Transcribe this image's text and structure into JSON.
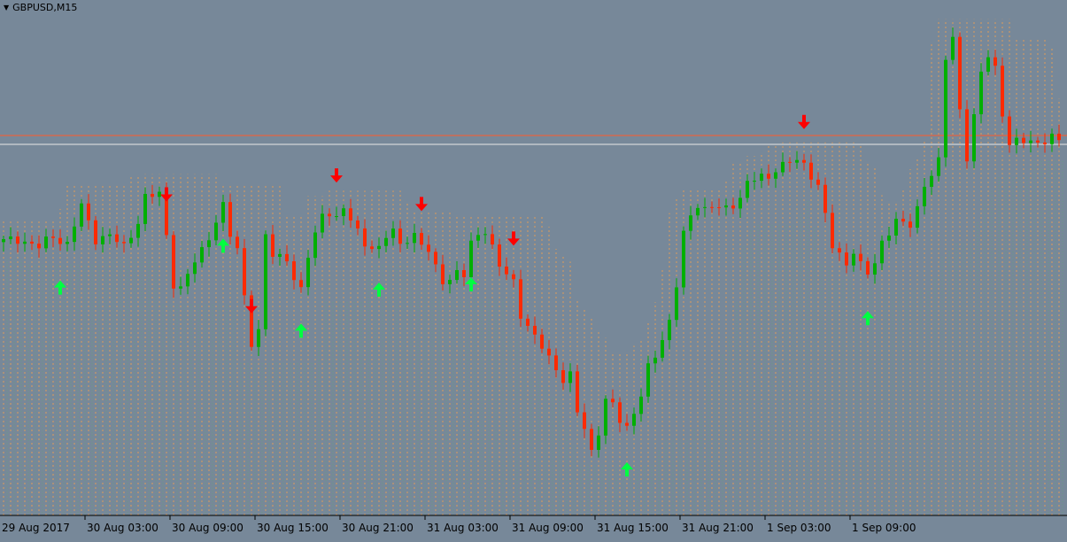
{
  "window": {
    "symbol_label": "GBPUSD,M15",
    "dropdown_icon": "triangle-down-icon"
  },
  "colors": {
    "background": "#778899",
    "bull_candle": "#00b000",
    "bear_candle": "#ff2a00",
    "upper_band": "#f0a050",
    "lower_band": "#66a080",
    "buy_arrow": "#00ff40",
    "sell_arrow": "#ff0000",
    "level_red": "#ff5a2a",
    "level_white": "#e8e8e8"
  },
  "chart_data": {
    "type": "candlestick",
    "symbol": "GBPUSD",
    "timeframe": "M15",
    "x_tick_labels": [
      "29 Aug 2017",
      "30 Aug 03:00",
      "30 Aug 09:00",
      "30 Aug 15:00",
      "30 Aug 21:00",
      "31 Aug 03:00",
      "31 Aug 09:00",
      "31 Aug 15:00",
      "31 Aug 21:00",
      "1 Sep 03:00",
      "1 Sep 09:00"
    ],
    "price_path": [
      [
        0,
        0.93
      ],
      [
        2,
        0.94
      ],
      [
        5,
        0.91
      ],
      [
        7,
        0.95
      ],
      [
        9,
        0.92
      ],
      [
        11,
        1.05
      ],
      [
        13,
        0.94
      ],
      [
        15,
        0.95
      ],
      [
        17,
        0.91
      ],
      [
        19,
        1.0
      ],
      [
        20,
        1.08
      ],
      [
        22,
        1.09
      ],
      [
        23,
        0.95
      ],
      [
        24,
        0.79
      ],
      [
        25,
        0.77
      ],
      [
        27,
        0.86
      ],
      [
        28,
        0.9
      ],
      [
        30,
        1.0
      ],
      [
        31,
        1.05
      ],
      [
        32,
        0.95
      ],
      [
        33,
        0.9
      ],
      [
        34,
        0.75
      ],
      [
        35,
        0.59
      ],
      [
        36,
        0.62
      ],
      [
        37,
        0.95
      ],
      [
        38,
        0.88
      ],
      [
        40,
        0.88
      ],
      [
        41,
        0.8
      ],
      [
        42,
        0.76
      ],
      [
        43,
        0.88
      ],
      [
        45,
        1.03
      ],
      [
        46,
        1.03
      ],
      [
        47,
        1.0
      ],
      [
        48,
        1.04
      ],
      [
        50,
        0.97
      ],
      [
        51,
        0.93
      ],
      [
        52,
        0.9
      ],
      [
        53,
        0.9
      ],
      [
        54,
        0.95
      ],
      [
        55,
        0.97
      ],
      [
        56,
        0.93
      ],
      [
        58,
        0.94
      ],
      [
        60,
        0.9
      ],
      [
        62,
        0.8
      ],
      [
        63,
        0.79
      ],
      [
        64,
        0.82
      ],
      [
        65,
        0.82
      ],
      [
        66,
        0.93
      ],
      [
        67,
        0.96
      ],
      [
        68,
        0.96
      ],
      [
        69,
        0.9
      ],
      [
        70,
        0.85
      ],
      [
        72,
        0.8
      ],
      [
        73,
        0.68
      ],
      [
        74,
        0.63
      ],
      [
        76,
        0.58
      ],
      [
        78,
        0.5
      ],
      [
        79,
        0.45
      ],
      [
        80,
        0.47
      ],
      [
        81,
        0.36
      ],
      [
        82,
        0.3
      ],
      [
        83,
        0.22
      ],
      [
        84,
        0.28
      ],
      [
        85,
        0.38
      ],
      [
        86,
        0.38
      ],
      [
        87,
        0.33
      ],
      [
        88,
        0.3
      ],
      [
        89,
        0.35
      ],
      [
        90,
        0.4
      ],
      [
        91,
        0.5
      ],
      [
        92,
        0.55
      ],
      [
        93,
        0.6
      ],
      [
        94,
        0.66
      ],
      [
        95,
        0.78
      ],
      [
        96,
        0.95
      ],
      [
        97,
        1.02
      ],
      [
        98,
        1.06
      ],
      [
        99,
        1.04
      ],
      [
        100,
        1.05
      ],
      [
        101,
        1.04
      ],
      [
        102,
        1.04
      ],
      [
        104,
        1.08
      ],
      [
        105,
        1.13
      ],
      [
        106,
        1.14
      ],
      [
        108,
        1.15
      ],
      [
        109,
        1.18
      ],
      [
        110,
        1.19
      ],
      [
        111,
        1.2
      ],
      [
        112,
        1.2
      ],
      [
        113,
        1.19
      ],
      [
        114,
        1.16
      ],
      [
        115,
        1.12
      ],
      [
        116,
        1.02
      ],
      [
        117,
        0.91
      ],
      [
        118,
        0.88
      ],
      [
        119,
        0.86
      ],
      [
        120,
        0.9
      ],
      [
        121,
        0.85
      ],
      [
        122,
        0.82
      ],
      [
        123,
        0.85
      ],
      [
        124,
        0.93
      ],
      [
        125,
        0.97
      ],
      [
        126,
        1.0
      ],
      [
        127,
        0.99
      ],
      [
        128,
        0.98
      ],
      [
        129,
        1.04
      ],
      [
        130,
        1.13
      ],
      [
        131,
        1.16
      ],
      [
        132,
        1.2
      ],
      [
        133,
        1.55
      ],
      [
        134,
        1.62
      ],
      [
        135,
        1.38
      ],
      [
        136,
        1.22
      ],
      [
        137,
        1.35
      ],
      [
        138,
        1.5
      ],
      [
        139,
        1.56
      ],
      [
        140,
        1.52
      ],
      [
        141,
        1.37
      ],
      [
        142,
        1.26
      ],
      [
        144,
        1.27
      ],
      [
        146,
        1.27
      ],
      [
        148,
        1.28
      ],
      [
        149,
        1.27
      ]
    ],
    "horizontal_levels": [
      {
        "name": "red_level",
        "y": 1.29
      },
      {
        "name": "white_level",
        "y": 1.26
      }
    ],
    "sell_signals_bar_index": [
      23,
      35,
      47,
      59,
      72,
      113
    ],
    "buy_signals_bar_index": [
      8,
      31,
      42,
      53,
      66,
      88,
      122
    ],
    "ylim": [
      0.0,
      1.75
    ],
    "grid": false
  }
}
